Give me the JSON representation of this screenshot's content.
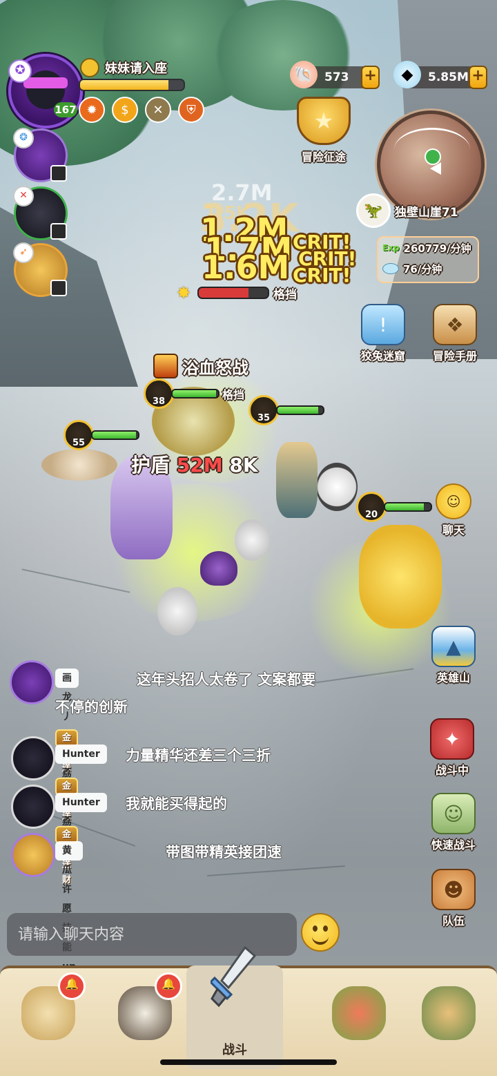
{
  "player": {
    "name": "妹妹请入座",
    "level": "167",
    "exp_fraction": 0.85
  },
  "currency": {
    "shells": "573",
    "gems": "5.85M"
  },
  "top_buttons": {
    "quest": "冒险征途"
  },
  "stage": {
    "name": "独壁山崖71",
    "exp_rate": "260779/分钟",
    "exp_tag": "Exp",
    "gem_rate": "76/分钟"
  },
  "boss": {
    "status": "格挡",
    "hp_fraction": 0.72
  },
  "damage_numbers": {
    "d1": "1.2M",
    "d2": "1.7M",
    "d3": "1.6M",
    "crit": "CRIT!",
    "ghost1": "2.7M",
    "ghost2": "3.2K",
    "ghost3": "1.5K"
  },
  "right_menu": {
    "maze": "狡兔迷窟",
    "handbook": "冒险手册",
    "chat": "聊天",
    "hero_mountain": "英雄山",
    "fighting": "战斗中",
    "quick_battle": "快速战斗",
    "team": "队伍"
  },
  "battle": {
    "skill": "浴血怒战",
    "skill_status": "格挡",
    "shield_label": "护盾",
    "shield_value": "52M",
    "shield_extra": "8K",
    "units": [
      {
        "level": "38",
        "hp": 0.95
      },
      {
        "level": "35",
        "hp": 0.9
      },
      {
        "level": "55",
        "hp": 0.95
      },
      {
        "level": "20",
        "hp": 0.85
      }
    ]
  },
  "chat": {
    "messages": [
      {
        "name": "画龙丿擎天",
        "tag": "",
        "text_line1": "这年头招人太卷了  文案都要",
        "text_line2": "不停的创新"
      },
      {
        "name": "Hunter荔",
        "tag": "金猪送财",
        "text_line1": "力量精华还差三个三折",
        "text_line2": ""
      },
      {
        "name": "Hunter荔",
        "tag": "金猪送财",
        "text_line1": "我就能买得起的",
        "text_line2": ""
      },
      {
        "name": "黄瓜许愿技能up",
        "tag": "金猪送财",
        "text_line1": "带图带精英接团速",
        "text_line2": ""
      }
    ],
    "input_placeholder": "请输入聊天内容"
  },
  "tabs": {
    "battle_label": "战斗"
  },
  "colors": {
    "gold": "#f3b51d",
    "hp_green": "#3fb531",
    "boss_red": "#d93b3b",
    "bell_red": "#e8473c"
  }
}
